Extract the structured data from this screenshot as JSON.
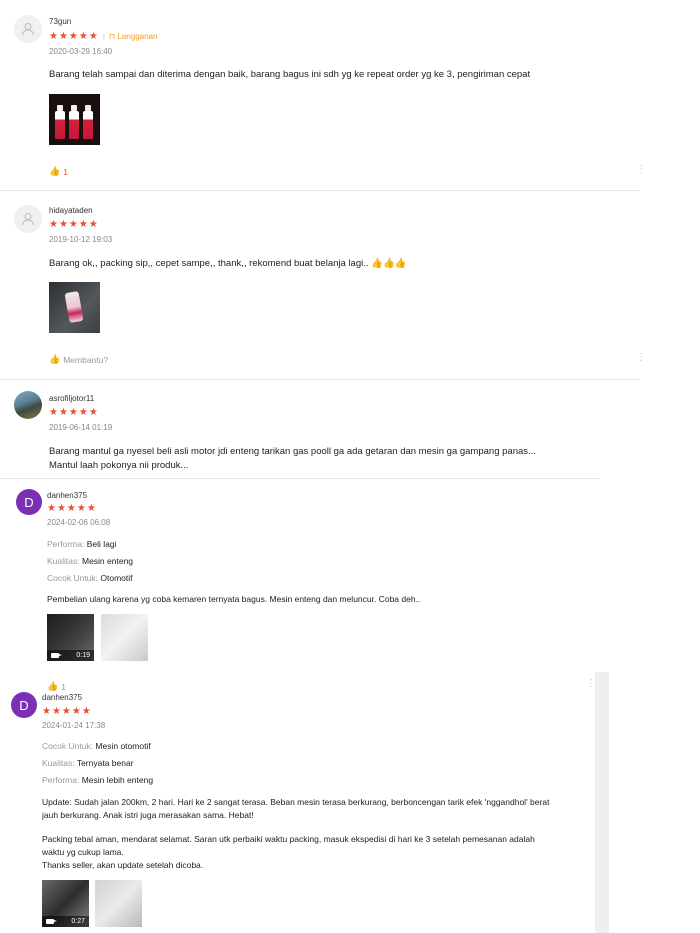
{
  "reviews": [
    {
      "username": "73gun",
      "stars": "★★★★★",
      "badge": "Langganan",
      "date": "2020-03-29 16:40",
      "text": "Barang telah sampai dan diterima dengan baik, barang bagus ini sdh yg ke repeat order yg ke 3, pengiriman cepat",
      "like_count": "1"
    },
    {
      "username": "hidayataden",
      "stars": "★★★★★",
      "date": "2019-10-12 19:03",
      "text": "Barang ok,, packing sip,, cepet sampe,, thank,, rekomend buat belanja lagi.. 👍👍👍",
      "helpful": "Membantu?"
    },
    {
      "username": "asrofiljotor11",
      "stars": "★★★★★",
      "date": "2019-06-14 01:19",
      "text_line1": "Barang mantul ga nyesel beli asli motor jdi enteng tarikan gas pooll ga ada getaran dan mesin ga gampang panas...",
      "text_line2": "Mantul laah pokonya nii produk..."
    },
    {
      "avatar_letter": "D",
      "username": "danhen375",
      "stars": "★★★★★",
      "date": "2024-02-06 06:08",
      "attrs": [
        {
          "k": "Performa:",
          "v": "Beli lagi"
        },
        {
          "k": "Kualitas:",
          "v": "Mesin enteng"
        },
        {
          "k": "Cocok Untuk:",
          "v": "Otomotif"
        }
      ],
      "text": "Pembelian ulang karena yg coba kemaren ternyata bagus. Mesin enteng dan meluncur. Coba deh..",
      "video_duration": "0:19",
      "like_count": "1"
    },
    {
      "avatar_letter": "D",
      "username": "danhen375",
      "stars": "★★★★★",
      "date": "2024-01-24 17:38",
      "attrs": [
        {
          "k": "Cocok Untuk:",
          "v": "Mesin otomotif"
        },
        {
          "k": "Kualitas:",
          "v": "Ternyata benar"
        },
        {
          "k": "Performa:",
          "v": "Mesin lebih enteng"
        }
      ],
      "para1_line1": "Update: Sudah jalan 200km, 2 hari. Hari ke 2 sangat terasa. Beban mesin terasa berkurang, berboncengan tarik efek 'nggandhol' berat",
      "para1_line2": "jauh berkurang. Anak istri juga merasakan sama. Hebat!",
      "para2_line1": "Packing tebal aman, mendarat selamat. Saran utk perbaiki waktu packing, masuk ekspedisi di hari ke 3 setelah pemesanan adalah",
      "para2_line2": "waktu yg cukup lama.",
      "para2_line3": "Thanks seller, akan update setelah dicoba.",
      "video_duration": "0:27"
    }
  ],
  "colors": {
    "accent": "#ee4d2d",
    "badge": "#f0a020",
    "avatar_purple": "#7b2fb5"
  }
}
